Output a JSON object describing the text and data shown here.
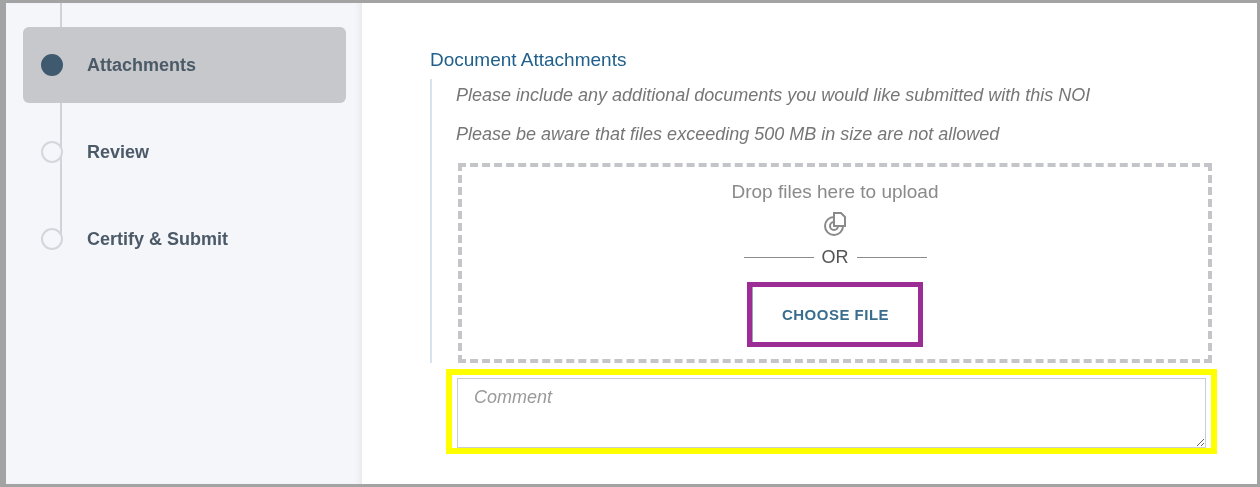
{
  "steps": [
    {
      "label": "Attachments",
      "selected": true
    },
    {
      "label": "Review",
      "selected": false
    },
    {
      "label": "Certify & Submit",
      "selected": false
    }
  ],
  "section": {
    "title": "Document Attachments",
    "notes": [
      "Please include any additional documents you would like submitted with this NOI",
      "Please be aware that files exceeding 500 MB in size are not allowed"
    ],
    "dropzone": {
      "prompt": "Drop files here to upload",
      "divider": "OR",
      "button": "CHOOSE FILE"
    },
    "comment": {
      "placeholder": "Comment"
    }
  }
}
